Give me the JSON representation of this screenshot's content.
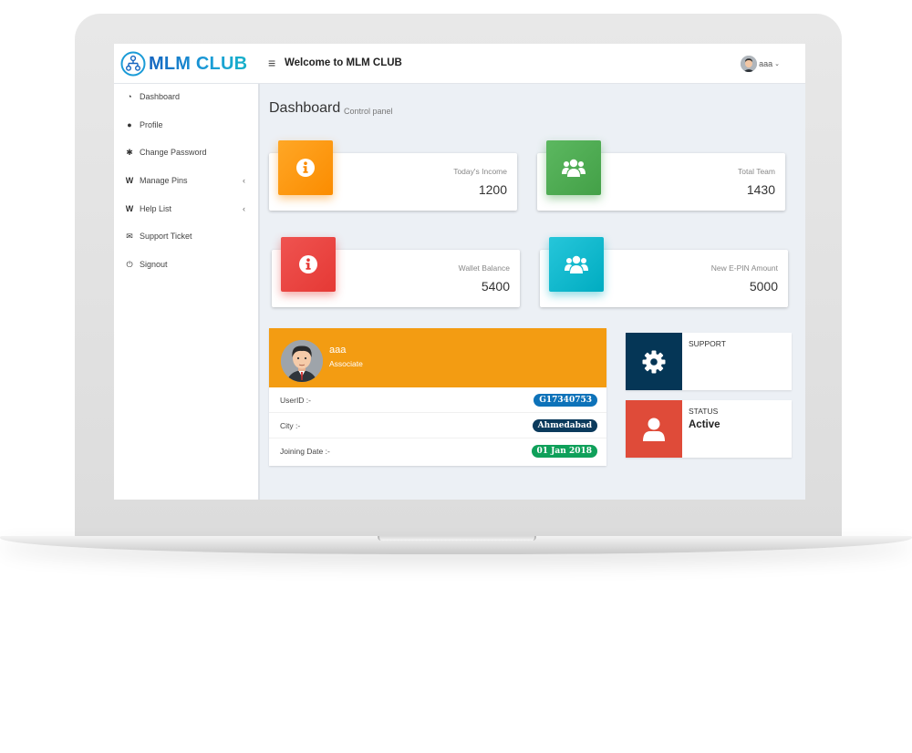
{
  "header": {
    "logo_text": "MLM CLUB",
    "welcome_text": "Welcome to MLM CLUB",
    "menu_icon": "hamburger-icon",
    "user_name": "aaa",
    "user_caret": "⌄"
  },
  "sidebar": {
    "items": [
      {
        "label": "Dashboard",
        "icon": "dashboard-icon",
        "glyph": "◔",
        "has_submenu": false
      },
      {
        "label": "Profile",
        "icon": "user-icon",
        "glyph": "●",
        "has_submenu": false
      },
      {
        "label": "Change Password",
        "icon": "gear-icon",
        "glyph": "✱",
        "has_submenu": false
      },
      {
        "label": "Manage Pins",
        "icon": "pin-icon",
        "glyph": "W",
        "has_submenu": true
      },
      {
        "label": "Help List",
        "icon": "pin-icon",
        "glyph": "W",
        "has_submenu": true
      },
      {
        "label": "Support Ticket",
        "icon": "envelope-icon",
        "glyph": "✉",
        "has_submenu": false
      },
      {
        "label": "Signout",
        "icon": "power-icon",
        "glyph": "⏻",
        "has_submenu": false
      }
    ],
    "submenu_caret": "‹"
  },
  "page": {
    "title": "Dashboard",
    "subtitle": "Control panel"
  },
  "info_cards": [
    {
      "label": "Today's Income",
      "value": "1200",
      "icon": "info-icon",
      "color": "#ff9a16"
    },
    {
      "label": "Total Team",
      "value": "1430",
      "icon": "users-icon",
      "color": "#4caf50"
    },
    {
      "label": "Wallet Balance",
      "value": "5400",
      "icon": "info-icon",
      "color": "#e8403f"
    },
    {
      "label": "New E-PIN Amount",
      "value": "5000",
      "icon": "users-icon",
      "color": "#1ab6c8"
    }
  ],
  "profile": {
    "name": "aaa",
    "role": "Associate",
    "header_color": "#f39c12",
    "rows": [
      {
        "label": "UserID :-",
        "value": "G17340753",
        "color": "#0d72b9"
      },
      {
        "label": "City :-",
        "value": "Ahmedabad",
        "color": "#0b3a5c"
      },
      {
        "label": "Joining Date :-",
        "value": "01 Jan 2018",
        "color": "#0fa05a"
      }
    ]
  },
  "side_boxes": [
    {
      "label": "SUPPORT",
      "value": "",
      "icon": "gear-icon",
      "color": "#053656"
    },
    {
      "label": "STATUS",
      "value": "Active",
      "icon": "user-icon",
      "color": "#df4b39"
    }
  ]
}
